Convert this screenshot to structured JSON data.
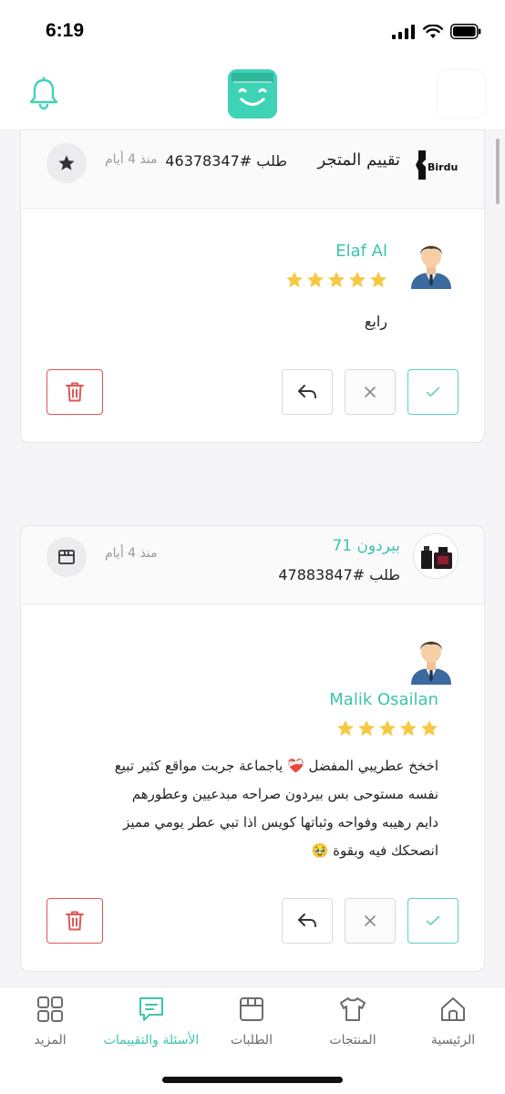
{
  "status_bar": {
    "time": "6:19"
  },
  "header": {
    "notifications_icon": "bell-icon",
    "logo_icon": "smiling-box-logo",
    "accent_color": "#3fd3b6"
  },
  "reviews": [
    {
      "header_title": "تقييم المتجر",
      "order_label": "طلب #46378347",
      "time_ago": "منذ 4 أيام",
      "store_logo_text": "Birdun",
      "type_icon": "star-icon",
      "reviewer_name": "Elaf Al",
      "rating": 5,
      "text": "رايع"
    },
    {
      "header_title": "بيردون 71",
      "order_label": "طلب #47883847",
      "time_ago": "منذ 4 أيام",
      "type_icon": "box-icon",
      "reviewer_name": "Malik Osailan",
      "rating": 5,
      "text_lines": [
        "اخخخ عطريبي المفضل ❤️‍🩹 ياجماعة جربت مواقع كثير تبيع",
        "نفسه مستوحى بس بيردون صراحه مبدعيين وعطورهم",
        "دايم رهيبه وفواحه وثباتها كويس اذا تبي عطر يومي مميز",
        "انصحكك فيه وبقوة 🥹"
      ]
    }
  ],
  "bottom_nav": {
    "items": [
      {
        "label": "الرئيسية",
        "icon": "home-icon"
      },
      {
        "label": "المنتجات",
        "icon": "shirt-icon"
      },
      {
        "label": "الطلبات",
        "icon": "orders-box-icon"
      },
      {
        "label": "الأسئلة والتقييمات",
        "icon": "chat-icon",
        "active": true
      },
      {
        "label": "المزيد",
        "icon": "grid-icon"
      }
    ],
    "active_color": "#3cc5ab"
  },
  "colors": {
    "accent": "#3cc5ab",
    "delete": "#e05656",
    "star": "#f7c844"
  }
}
